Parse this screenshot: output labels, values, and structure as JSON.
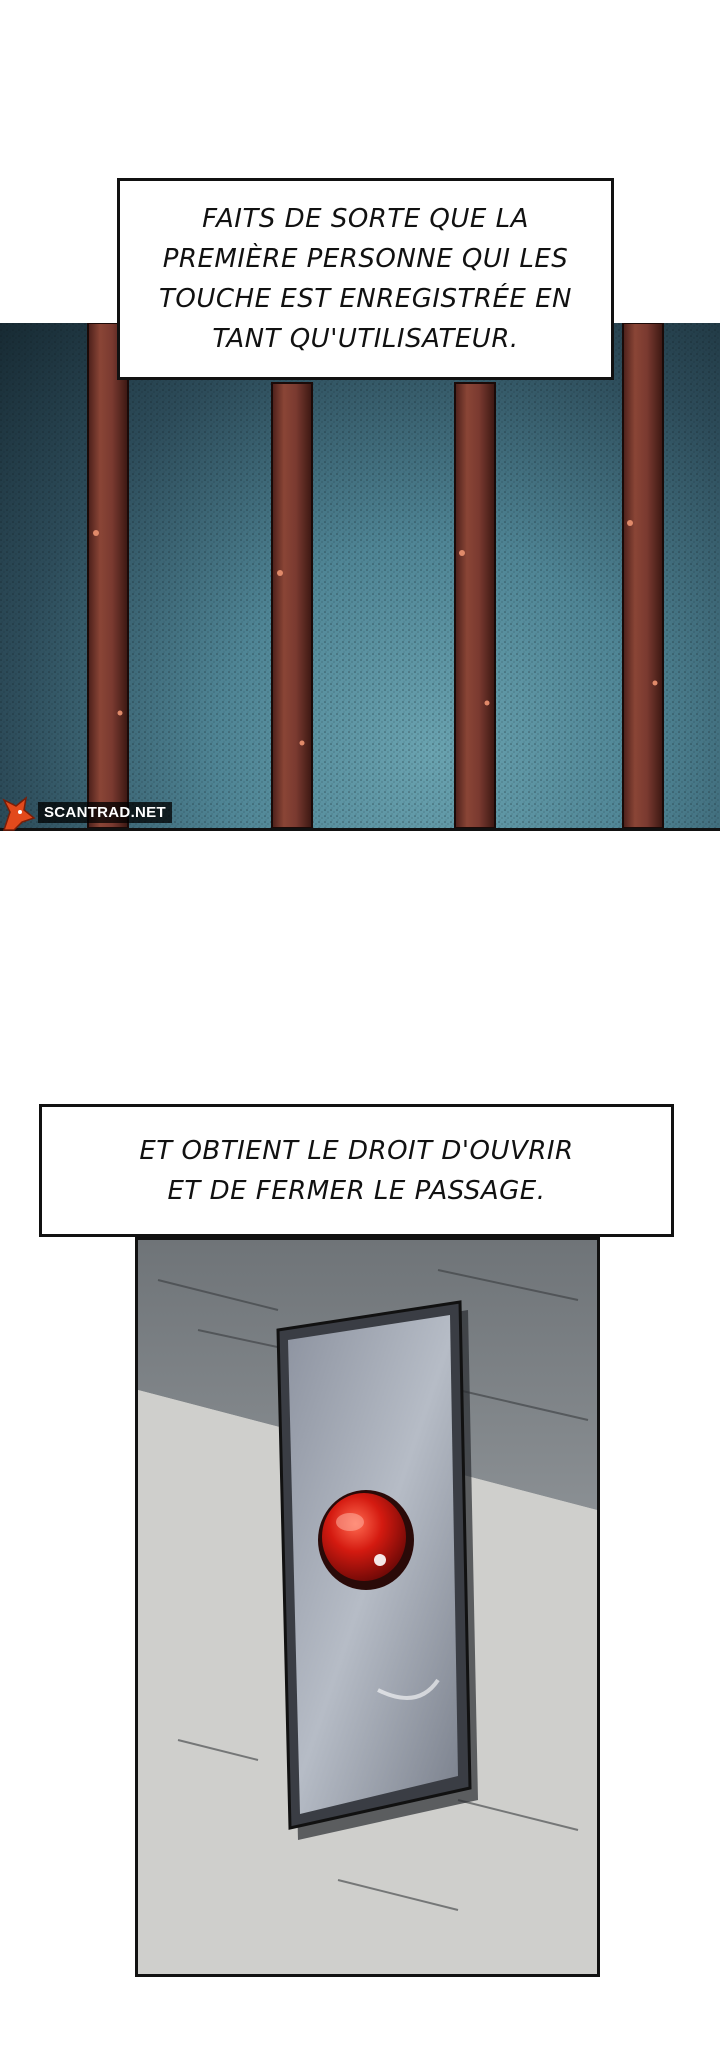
{
  "caption_1": {
    "text": "FAITS DE SORTE QUE LA\nPREMIÈRE PERSONNE QUI LES\nTOUCHE EST ENREGISTRÉE EN\nTANT QU'UTILISATEUR."
  },
  "caption_2": {
    "text": "ET OBTIENT LE DROIT D'OUVRIR\nET DE FERMER LE PASSAGE."
  },
  "watermark": {
    "text": "SCANTRAD.NET"
  },
  "colors": {
    "bars_bg": "#4f8595",
    "bar": "#7a3a30",
    "button_red": "#d41a10",
    "wall": "#c9c9c6"
  }
}
